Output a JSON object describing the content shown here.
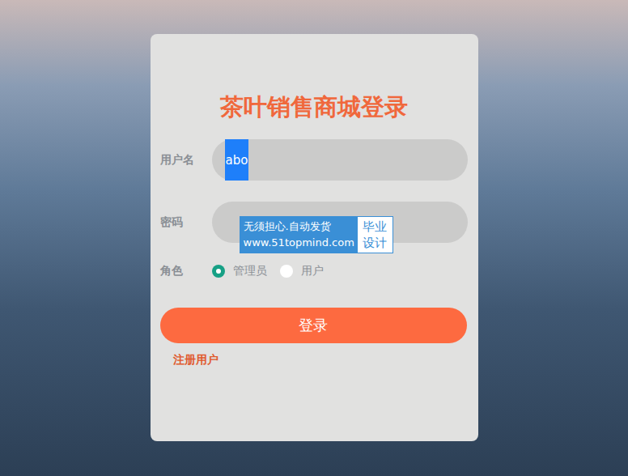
{
  "page": {
    "title": "茶叶销售商城登录"
  },
  "fields": [
    {
      "label": "用户名",
      "value": "abo",
      "kind": "text",
      "text_selected": true,
      "has_watermark": false
    },
    {
      "label": "密码",
      "value": "",
      "kind": "password",
      "text_selected": false,
      "has_watermark": true
    }
  ],
  "role": {
    "label": "角色",
    "options": [
      {
        "label": "管理员",
        "selected": true
      },
      {
        "label": "用户",
        "selected": false
      }
    ]
  },
  "login_button": "登录",
  "register_link": "注册用户",
  "watermark": {
    "line1": "无须担心.自动发货",
    "line2": "www.51topmind.com",
    "badge": "毕业设计"
  }
}
